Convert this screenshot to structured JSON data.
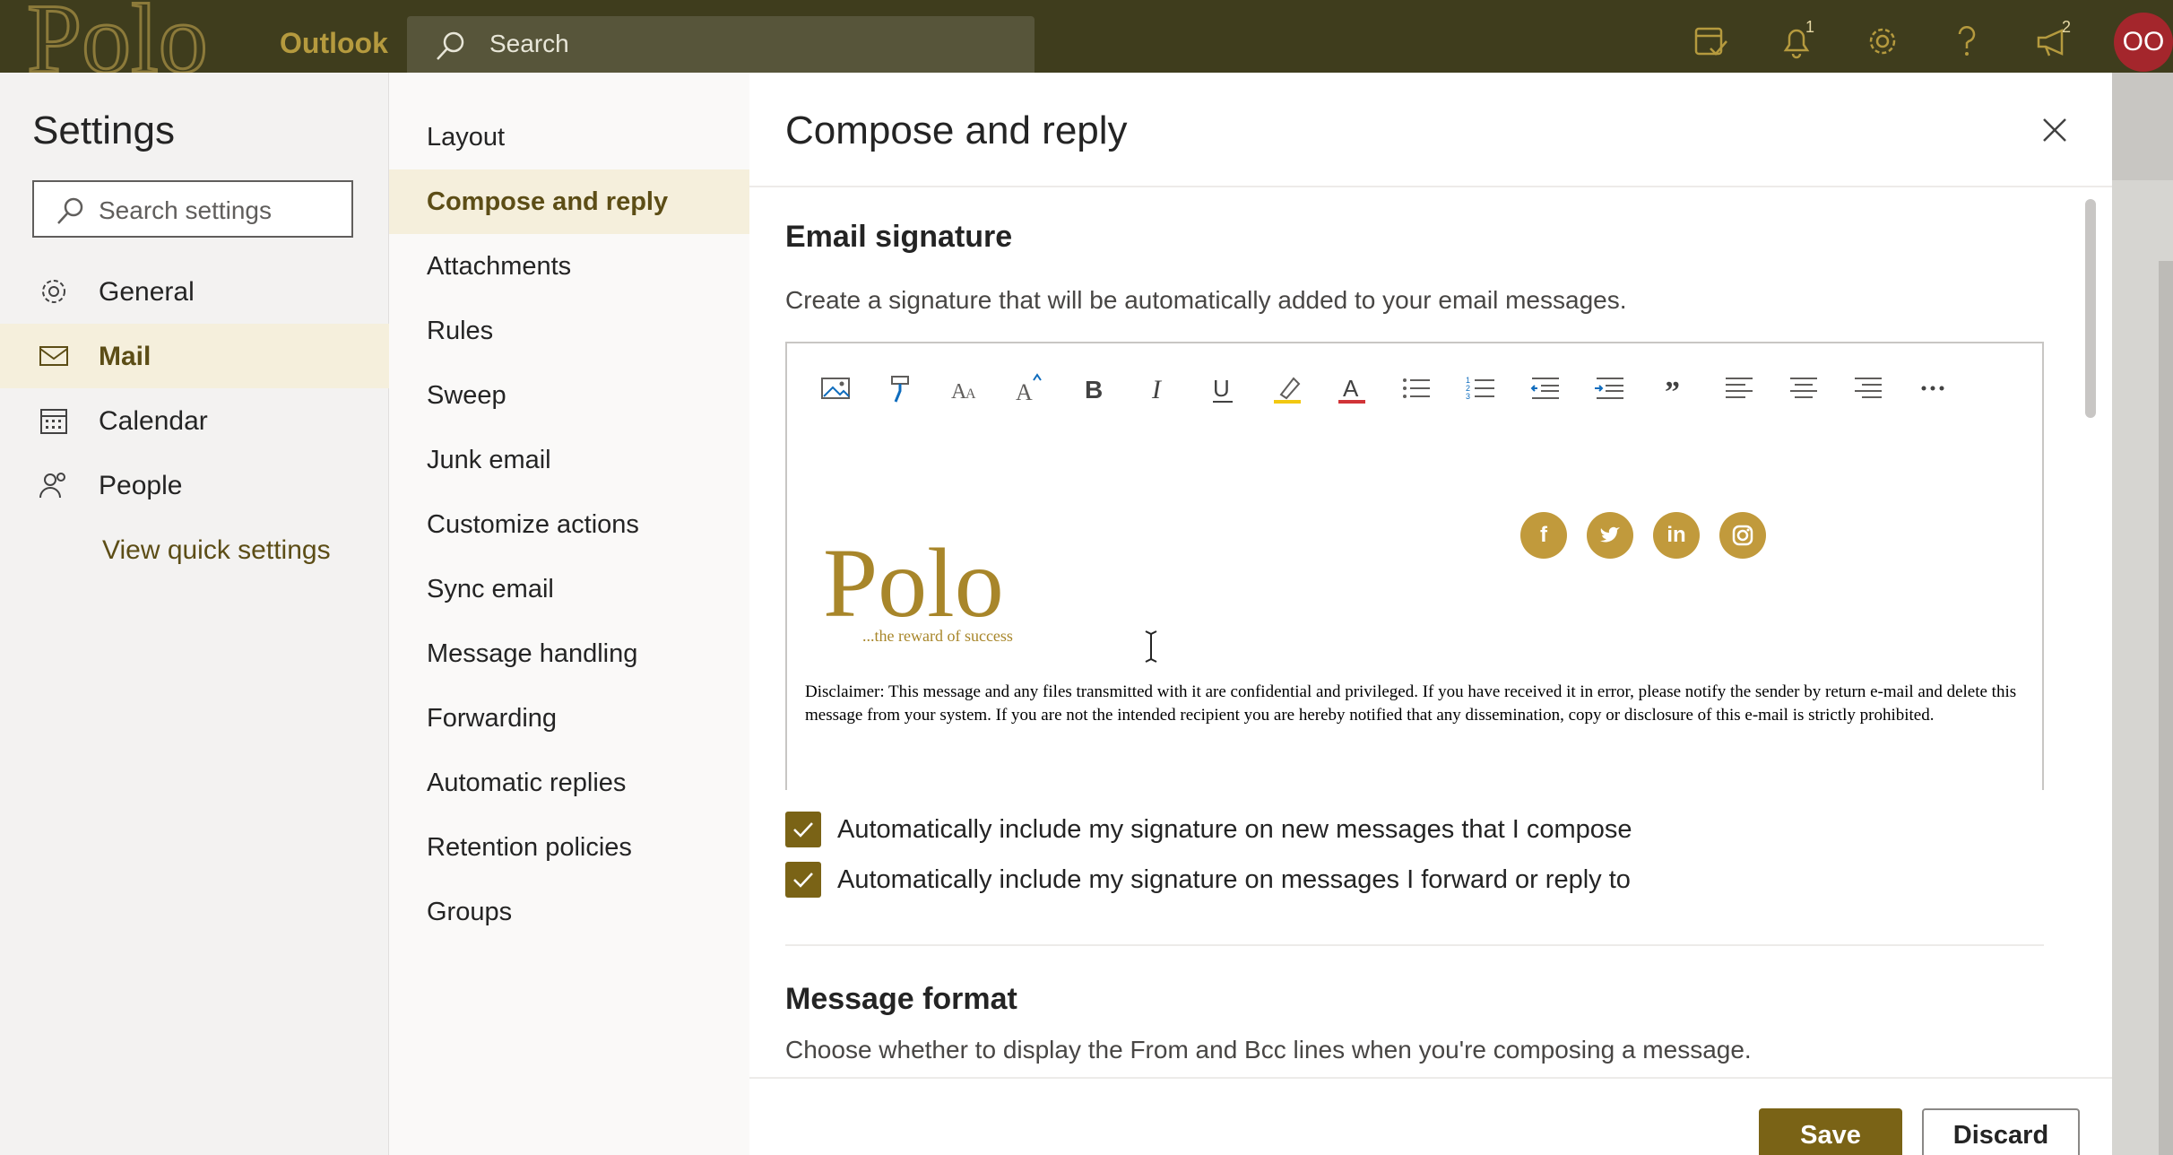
{
  "topbar": {
    "logo_text": "Polo",
    "app_name": "Outlook",
    "search_placeholder": "Search",
    "notifications_badge": "1",
    "feedback_badge": "2",
    "avatar_initials": "OO"
  },
  "settings": {
    "title": "Settings",
    "search_placeholder": "Search settings",
    "categories": [
      {
        "label": "General",
        "icon": "gear-icon"
      },
      {
        "label": "Mail",
        "icon": "mail-icon"
      },
      {
        "label": "Calendar",
        "icon": "calendar-icon"
      },
      {
        "label": "People",
        "icon": "people-icon"
      }
    ],
    "selected_category": "Mail",
    "quick_settings_link": "View quick settings"
  },
  "mail_nav": {
    "items": [
      "Layout",
      "Compose and reply",
      "Attachments",
      "Rules",
      "Sweep",
      "Junk email",
      "Customize actions",
      "Sync email",
      "Message handling",
      "Forwarding",
      "Automatic replies",
      "Retention policies",
      "Groups"
    ],
    "selected": "Compose and reply"
  },
  "panel": {
    "title": "Compose and reply",
    "signature": {
      "heading": "Email signature",
      "description": "Create a signature that will be automatically added to your email messages.",
      "toolbar_icons": [
        "insert-image-icon",
        "format-painter-icon",
        "font-icon",
        "font-size-icon",
        "bold-icon",
        "italic-icon",
        "underline-icon",
        "highlight-icon",
        "font-color-icon",
        "bullets-icon",
        "numbering-icon",
        "decrease-indent-icon",
        "increase-indent-icon",
        "quote-icon",
        "align-left-icon",
        "align-center-icon",
        "align-right-icon",
        "more-options-icon"
      ],
      "logo_text": "Polo",
      "logo_tagline": "...the reward of success",
      "social_icons": [
        "facebook-icon",
        "twitter-icon",
        "linkedin-icon",
        "instagram-icon"
      ],
      "disclaimer": "Disclaimer: This message and any files transmitted with it are confidential and privileged. If you have received it in error, please notify the sender by return e-mail and delete this message from your system. If you are not the intended recipient you are hereby notified that any dissemination, copy or disclosure of this e-mail is strictly prohibited."
    },
    "options": [
      {
        "label": "Automatically include my signature on new messages that I compose",
        "checked": true
      },
      {
        "label": "Automatically include my signature on messages I forward or reply to",
        "checked": true
      }
    ],
    "message_format": {
      "heading": "Message format",
      "description": "Choose whether to display the From and Bcc lines when you're composing a message."
    },
    "save_label": "Save",
    "discard_label": "Discard"
  },
  "colors": {
    "topbar": "#3f3d1d",
    "accent": "#7a6316",
    "selected_bg": "#f5efdc",
    "brand_gold": "#c19a3c"
  }
}
